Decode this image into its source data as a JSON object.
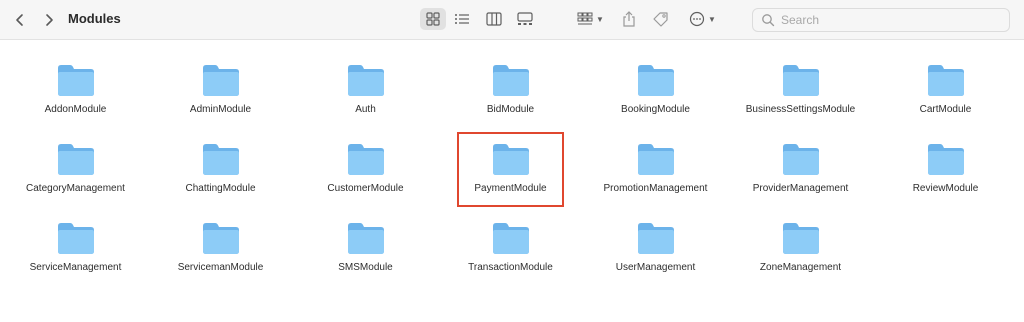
{
  "window": {
    "title": "Modules",
    "back_icon": "chevron-left-icon",
    "forward_icon": "chevron-right-icon"
  },
  "toolbar": {
    "view_modes": [
      {
        "name": "icon-view",
        "icon": "grid-icon",
        "active": true
      },
      {
        "name": "list-view",
        "icon": "list-icon",
        "active": false
      },
      {
        "name": "column-view",
        "icon": "columns-icon",
        "active": false
      },
      {
        "name": "gallery-view",
        "icon": "gallery-icon",
        "active": false
      }
    ],
    "group_icon": "group-grid-icon",
    "share_icon": "share-icon",
    "tag_icon": "tag-icon",
    "more_icon": "ellipsis-circle-icon"
  },
  "search": {
    "placeholder": "Search",
    "value": ""
  },
  "colors": {
    "folder_front": "#8dccf7",
    "folder_back": "#6cb3ea",
    "selection_border": "#e0472f",
    "toolbar_bg": "#f6f6f6"
  },
  "folders": [
    {
      "name": "AddonModule"
    },
    {
      "name": "AdminModule"
    },
    {
      "name": "Auth"
    },
    {
      "name": "BidModule"
    },
    {
      "name": "BookingModule"
    },
    {
      "name": "BusinessSettingsModule"
    },
    {
      "name": "CartModule"
    },
    {
      "name": "CategoryManagement"
    },
    {
      "name": "ChattingModule"
    },
    {
      "name": "CustomerModule"
    },
    {
      "name": "PaymentModule",
      "highlighted": true
    },
    {
      "name": "PromotionManagement"
    },
    {
      "name": "ProviderManagement"
    },
    {
      "name": "ReviewModule"
    },
    {
      "name": "ServiceManagement"
    },
    {
      "name": "ServicemanModule"
    },
    {
      "name": "SMSModule"
    },
    {
      "name": "TransactionModule"
    },
    {
      "name": "UserManagement"
    },
    {
      "name": "ZoneManagement"
    }
  ]
}
